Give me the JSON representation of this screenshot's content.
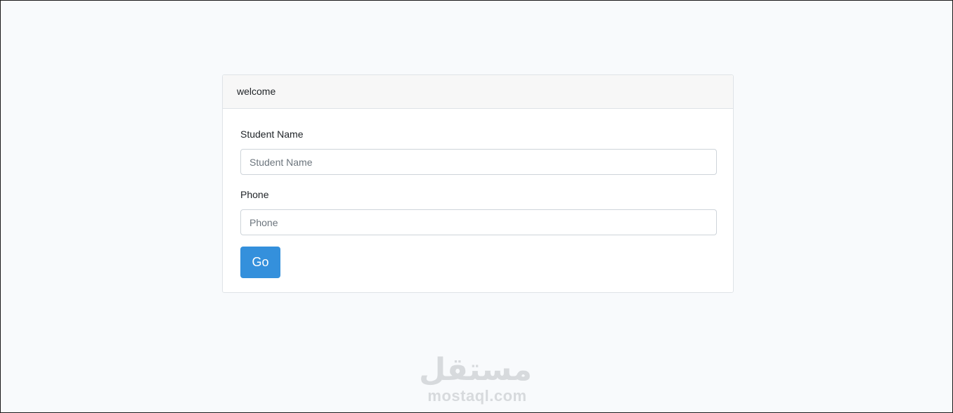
{
  "card": {
    "header_title": "welcome"
  },
  "form": {
    "student_name": {
      "label": "Student Name",
      "placeholder": "Student Name",
      "value": ""
    },
    "phone": {
      "label": "Phone",
      "placeholder": "Phone",
      "value": ""
    },
    "submit_label": "Go"
  },
  "watermark": {
    "logo_text": "مستقل",
    "site_text": "mostaql.com"
  },
  "colors": {
    "page_background": "#f8fafc",
    "card_header_background": "#f7f7f7",
    "button_primary": "#3490dc",
    "watermark": "#d7dadd"
  }
}
